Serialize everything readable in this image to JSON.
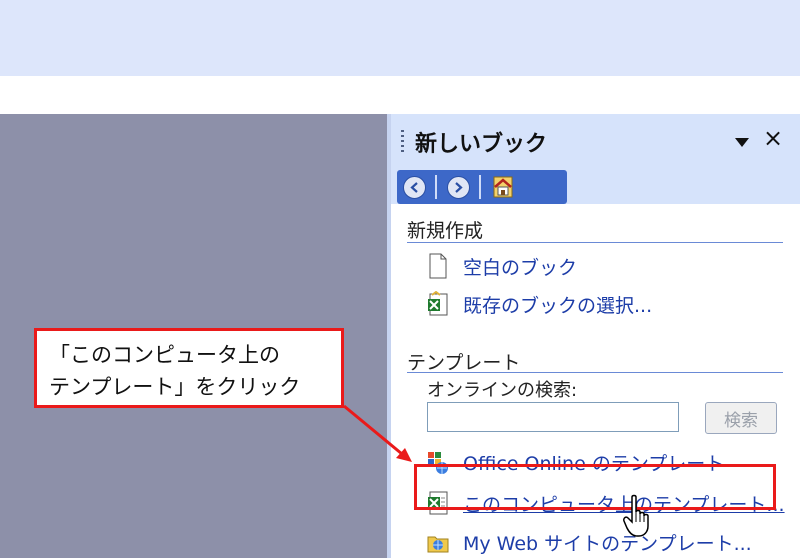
{
  "task_pane": {
    "title": "新しいブック",
    "nav": {
      "back_icon": "back-arrow-icon",
      "forward_icon": "forward-arrow-icon",
      "home_icon": "home-icon"
    },
    "sections": {
      "new": {
        "heading": "新規作成",
        "items": [
          {
            "label": "空白のブック",
            "icon": "blank-document-icon"
          },
          {
            "label": "既存のブックの選択...",
            "icon": "excel-workbook-icon"
          }
        ]
      },
      "templates": {
        "heading": "テンプレート",
        "search_label": "オンラインの検索:",
        "search_value": "",
        "search_button": "検索",
        "items": [
          {
            "label": "Office Online のテンプレート",
            "icon": "office-online-icon"
          },
          {
            "label": "このコンピュータ上のテンプレート...",
            "icon": "excel-template-icon",
            "highlighted": true
          },
          {
            "label": "My Web サイトのテンプレート...",
            "icon": "web-folder-icon"
          }
        ]
      }
    }
  },
  "annotation": {
    "line1": "「このコンピュータ上の",
    "line2": "テンプレート」をクリック"
  },
  "colors": {
    "annotation_red": "#ea1a1a",
    "pane_background": "#d6e3fb",
    "nav_bar": "#3d68c8",
    "workspace": "#8d90a9",
    "link": "#1d3da8"
  }
}
